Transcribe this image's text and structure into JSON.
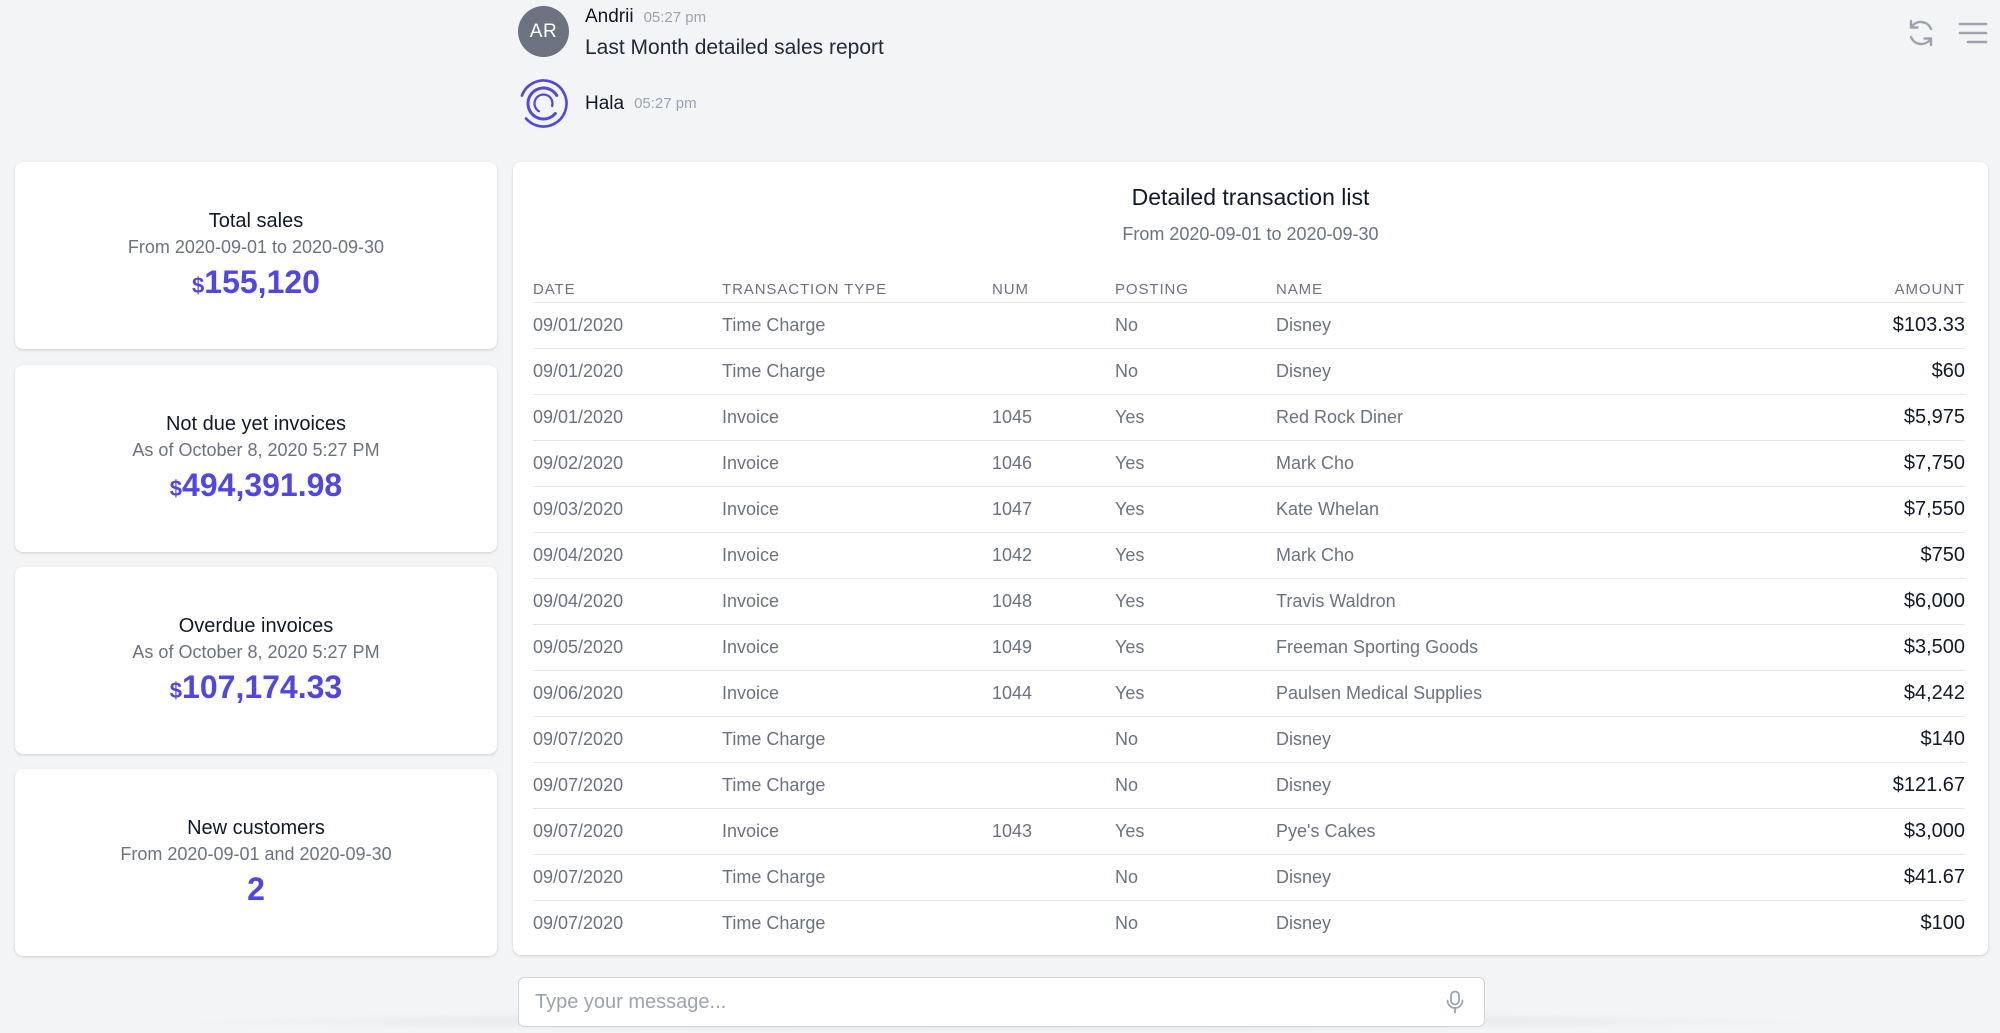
{
  "chat": {
    "user_message": {
      "avatar_initials": "AR",
      "author": "Andrii",
      "time": "05:27 pm",
      "text": "Last Month detailed sales report"
    },
    "bot_message": {
      "author": "Hala",
      "time": "05:27 pm",
      "avatar_icon": "hala-logo-icon"
    }
  },
  "top_actions": {
    "refresh_icon": "refresh-icon",
    "menu_icon": "hamburger-menu-icon"
  },
  "kpis": [
    {
      "title": "Total sales",
      "subtitle": "From 2020-09-01 to 2020-09-30",
      "currency": "$",
      "value": "155,120"
    },
    {
      "title": "Not due yet invoices",
      "subtitle": "As of October 8, 2020 5:27 PM",
      "currency": "$",
      "value": "494,391.98"
    },
    {
      "title": "Overdue invoices",
      "subtitle": "As of October 8, 2020 5:27 PM",
      "currency": "$",
      "value": "107,174.33"
    },
    {
      "title": "New customers",
      "subtitle": "From 2020-09-01 and 2020-09-30",
      "currency": "",
      "value": "2"
    }
  ],
  "transactions": {
    "title": "Detailed transaction list",
    "subtitle": "From 2020-09-01 to 2020-09-30",
    "columns": [
      "DATE",
      "TRANSACTION TYPE",
      "NUM",
      "POSTING",
      "NAME",
      "AMOUNT"
    ],
    "rows": [
      [
        "09/01/2020",
        "Time Charge",
        "",
        "No",
        "Disney",
        "$103.33"
      ],
      [
        "09/01/2020",
        "Time Charge",
        "",
        "No",
        "Disney",
        "$60"
      ],
      [
        "09/01/2020",
        "Invoice",
        "1045",
        "Yes",
        "Red Rock Diner",
        "$5,975"
      ],
      [
        "09/02/2020",
        "Invoice",
        "1046",
        "Yes",
        "Mark Cho",
        "$7,750"
      ],
      [
        "09/03/2020",
        "Invoice",
        "1047",
        "Yes",
        "Kate Whelan",
        "$7,550"
      ],
      [
        "09/04/2020",
        "Invoice",
        "1042",
        "Yes",
        "Mark Cho",
        "$750"
      ],
      [
        "09/04/2020",
        "Invoice",
        "1048",
        "Yes",
        "Travis Waldron",
        "$6,000"
      ],
      [
        "09/05/2020",
        "Invoice",
        "1049",
        "Yes",
        "Freeman Sporting Goods",
        "$3,500"
      ],
      [
        "09/06/2020",
        "Invoice",
        "1044",
        "Yes",
        "Paulsen Medical Supplies",
        "$4,242"
      ],
      [
        "09/07/2020",
        "Time Charge",
        "",
        "No",
        "Disney",
        "$140"
      ],
      [
        "09/07/2020",
        "Time Charge",
        "",
        "No",
        "Disney",
        "$121.67"
      ],
      [
        "09/07/2020",
        "Invoice",
        "1043",
        "Yes",
        "Pye's Cakes",
        "$3,000"
      ],
      [
        "09/07/2020",
        "Time Charge",
        "",
        "No",
        "Disney",
        "$41.67"
      ],
      [
        "09/07/2020",
        "Time Charge",
        "",
        "No",
        "Disney",
        "$100"
      ]
    ]
  },
  "composer": {
    "placeholder": "Type your message...",
    "value": "",
    "mic_icon": "microphone-icon"
  },
  "colors": {
    "accent": "#4f46e5",
    "background": "#f3f4f6",
    "card": "#ffffff",
    "muted_text": "#6b7280"
  }
}
